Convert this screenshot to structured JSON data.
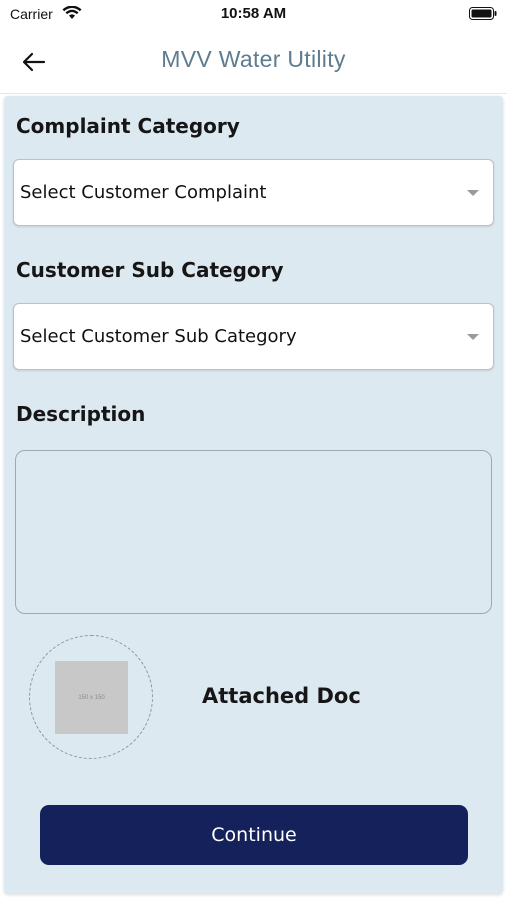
{
  "status_bar": {
    "carrier": "Carrier",
    "time": "10:58 AM"
  },
  "nav": {
    "title": "MVV Water Utility",
    "title_color": "#5d7c8f"
  },
  "form": {
    "complaint_category_label": "Complaint Category",
    "complaint_category_value": "Select Customer Complaint",
    "sub_category_label": "Customer Sub Category",
    "sub_category_value": "Select Customer Sub Category",
    "description_label": "Description",
    "description_value": "",
    "attachment_placeholder": "150 x 150",
    "attached_doc_label": "Attached Doc",
    "continue_label": "Continue"
  },
  "colors": {
    "card_background": "#dde9f1",
    "button_background": "#15215a"
  },
  "icons": {
    "back": "arrow-left-icon",
    "wifi": "wifi-icon",
    "battery": "battery-icon",
    "dropdown": "chevron-down-icon"
  }
}
